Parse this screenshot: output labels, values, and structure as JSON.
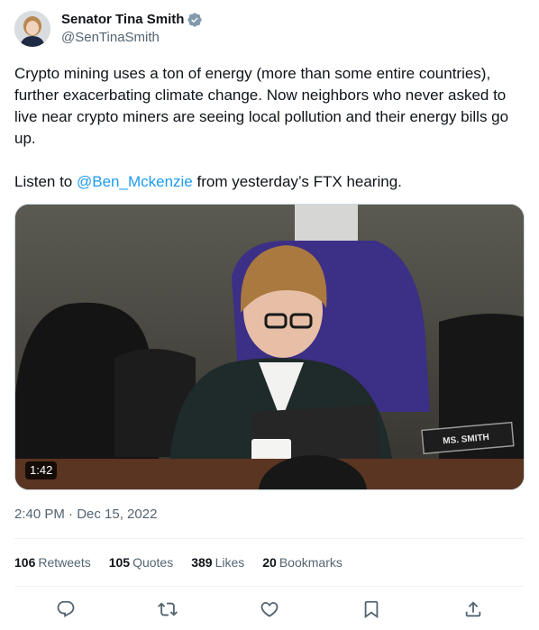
{
  "author": {
    "display_name": "Senator Tina Smith",
    "handle": "@SenTinaSmith",
    "verified": true
  },
  "tweet": {
    "paragraph_1": "Crypto mining uses a ton of energy (more than some entire countries), further exacerbating climate change. Now neighbors who never asked to live near crypto miners are seeing local pollution and their energy bills go up.",
    "paragraph_2_prefix": "Listen to ",
    "mention": "@Ben_Mckenzie",
    "paragraph_2_suffix": " from yesterday’s FTX hearing."
  },
  "media": {
    "type": "video",
    "duration": "1:42",
    "nameplate": "MS. SMITH"
  },
  "meta": {
    "timestamp": "2:40 PM · Dec 15, 2022"
  },
  "stats": [
    {
      "count": "106",
      "label": "Retweets"
    },
    {
      "count": "105",
      "label": "Quotes"
    },
    {
      "count": "389",
      "label": "Likes"
    },
    {
      "count": "20",
      "label": "Bookmarks"
    }
  ],
  "actions": [
    "reply-icon",
    "retweet-icon",
    "like-icon",
    "bookmark-icon",
    "share-icon"
  ],
  "colors": {
    "text": "#0f1419",
    "secondary": "#536471",
    "link": "#1d9bf0",
    "divider": "#eff3f4"
  }
}
